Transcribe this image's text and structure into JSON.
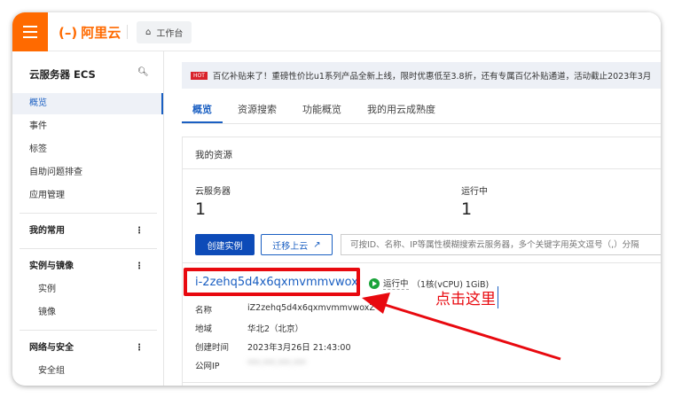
{
  "topbar": {
    "brand": "阿里云",
    "workbench": "工作台"
  },
  "sidebar": {
    "title": "云服务器 ECS",
    "items": [
      "概览",
      "事件",
      "标签",
      "自助问题排查",
      "应用管理"
    ],
    "groups": [
      {
        "label": "我的常用",
        "items": []
      },
      {
        "label": "实例与镜像",
        "items": [
          "实例",
          "镜像"
        ]
      },
      {
        "label": "网络与安全",
        "items": [
          "安全组"
        ]
      }
    ]
  },
  "banner": {
    "badge": "HOT",
    "text": "百亿补贴来了！重磅性价比u1系列产品全新上线，限时优惠低至3.8折，还有专属百亿补贴通道，活动截止2023年3月"
  },
  "tabs": [
    "概览",
    "资源搜索",
    "功能概览",
    "我的用云成熟度"
  ],
  "resources": {
    "title": "我的资源",
    "stats": [
      {
        "label": "云服务器",
        "value": "1"
      },
      {
        "label": "运行中",
        "value": "1"
      }
    ],
    "create_button": "创建实例",
    "migrate_button": "迁移上云",
    "search_placeholder": "可按ID、名称、IP等属性模糊搜索云服务器，多个关键字用英文逗号（,）分隔"
  },
  "instance": {
    "id": "i-2zehq5d4x6qxmvmmvwox",
    "status": "运行中",
    "spec": "（1核(vCPU) 1GiB)",
    "rows": [
      {
        "label": "名称",
        "value": "iZ2zehq5d4x6qxmvmmvwoxZ"
      },
      {
        "label": "地域",
        "value": "华北2（北京）"
      },
      {
        "label": "创建时间",
        "value": "2023年3月26日 21:43:00"
      },
      {
        "label": "公网IP",
        "value": "***.***.***.***"
      }
    ]
  },
  "annotation": {
    "text": "点击这里",
    "color": "#e8090f"
  }
}
